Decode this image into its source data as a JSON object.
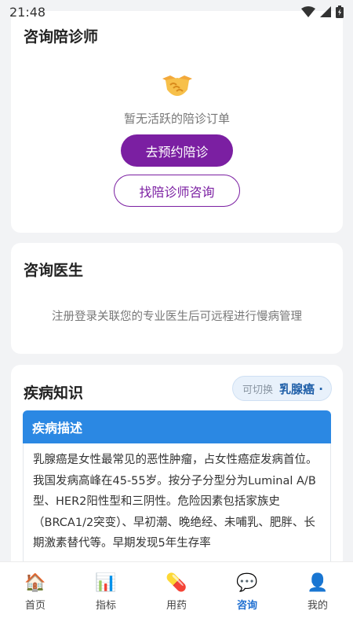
{
  "status_bar": {
    "time": "21:48"
  },
  "escort": {
    "title": "咨询陪诊师",
    "empty_text": "暂无活跃的陪诊订单",
    "book_button": "去预约陪诊",
    "consult_button": "找陪诊师咨询"
  },
  "doctor": {
    "title": "咨询医生",
    "empty_text": "注册登录关联您的专业医生后可远程进行慢病管理"
  },
  "knowledge": {
    "title": "疾病知识",
    "switch_label": "可切换",
    "switch_value": "乳腺癌 ·",
    "section_title": "疾病描述",
    "description": "乳腺癌是女性最常见的恶性肿瘤，占女性癌症发病首位。我国发病高峰在45-55岁。按分子分型分为Luminal A/B型、HER2阳性型和三阴性。危险因素包括家族史（BRCA1/2突变）、早初潮、晚绝经、未哺乳、肥胖、长期激素替代等。早期发现5年生存率"
  },
  "tabs": [
    {
      "label": "首页",
      "icon": "🏠",
      "icon_name": "home-icon"
    },
    {
      "label": "指标",
      "icon": "📊",
      "icon_name": "chart-icon"
    },
    {
      "label": "用药",
      "icon": "💊",
      "icon_name": "pill-icon"
    },
    {
      "label": "咨询",
      "icon": "💬",
      "icon_name": "chat-icon",
      "active": true
    },
    {
      "label": "我的",
      "icon": "👤",
      "icon_name": "user-icon"
    }
  ],
  "colors": {
    "primary_purple": "#7b1fa2",
    "header_blue": "#2b88e3",
    "active_tab": "#1f6fd1"
  }
}
